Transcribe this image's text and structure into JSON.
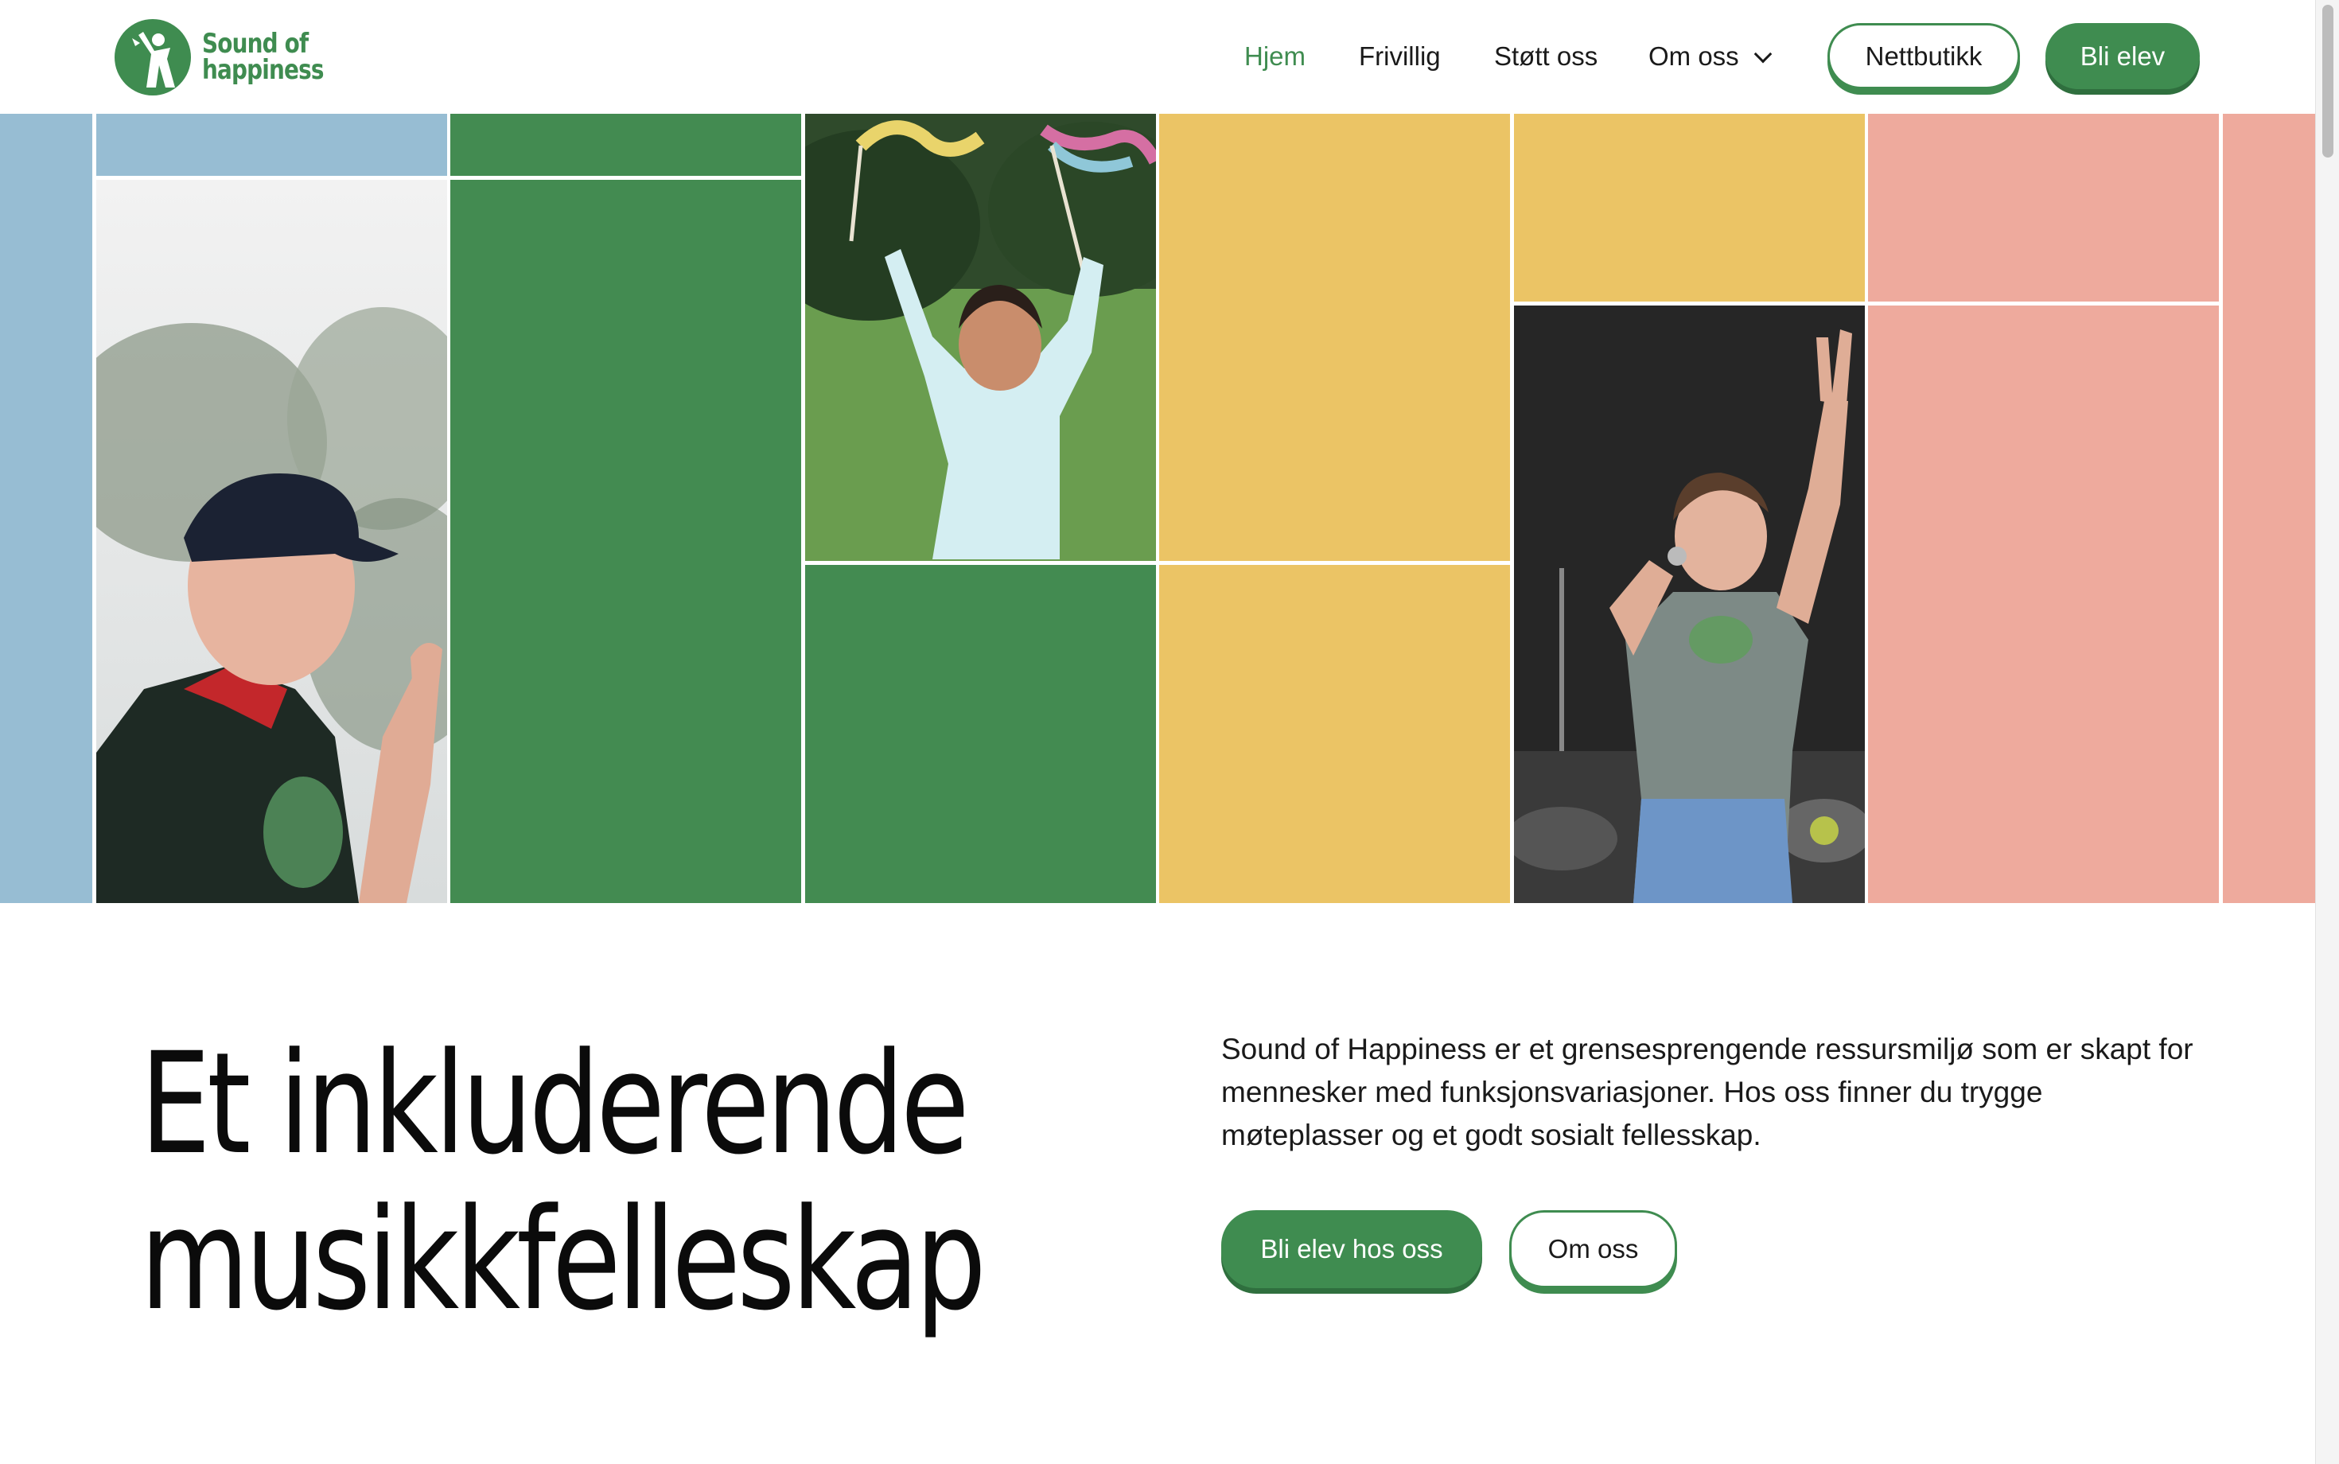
{
  "brand": {
    "name_line1": "Sound of",
    "name_line2": "happiness",
    "color": "#3f8c50"
  },
  "nav": {
    "items": [
      {
        "label": "Hjem",
        "active": true
      },
      {
        "label": "Frivillig",
        "active": false
      },
      {
        "label": "Støtt oss",
        "active": false
      },
      {
        "label": "Om oss",
        "active": false,
        "has_dropdown": true
      }
    ],
    "shop_button": "Nettbutikk",
    "join_button": "Bli elev"
  },
  "hero": {
    "tile_colors": {
      "blue": "#97bdd3",
      "green": "#438b51",
      "yellow": "#ebc465",
      "pink": "#eeaa9d"
    },
    "photos": [
      {
        "description": "smiling young man in cap",
        "icon": "photo"
      },
      {
        "description": "child waving ribbons in park",
        "icon": "photo"
      },
      {
        "description": "young man singing on stage",
        "icon": "photo"
      }
    ]
  },
  "main": {
    "headline_line1": "Et inkluderende",
    "headline_line2": "musikkfelleskap",
    "intro": "Sound of Happiness er et grensesprengende ressursmiljø som er skapt for mennesker med funksjonsvariasjoner. Hos oss finner du trygge møteplasser og et godt sosialt fellesskap.",
    "cta_primary": "Bli elev hos oss",
    "cta_secondary": "Om oss"
  }
}
